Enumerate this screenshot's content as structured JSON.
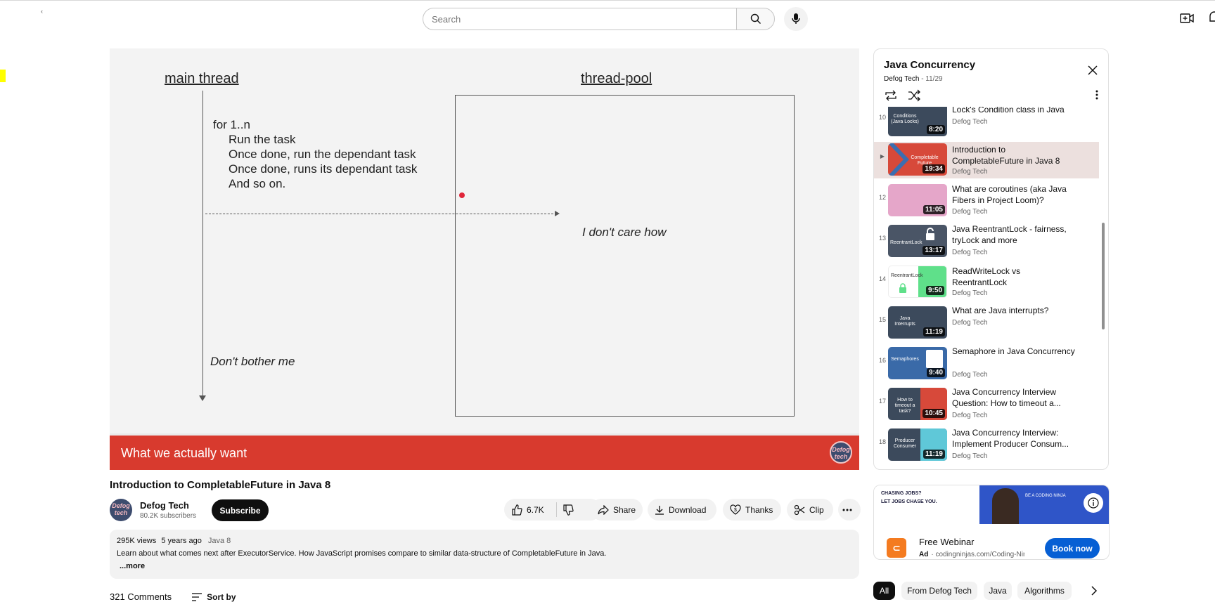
{
  "header": {
    "search_placeholder": "Search"
  },
  "video": {
    "slide": {
      "main_thread_title": "main thread",
      "pool_title": "thread-pool",
      "task_lines": [
        "for 1..n",
        "Run the task",
        "Once done, run the dependant task",
        "Once done, runs its dependant task",
        "And so on."
      ],
      "dont_care": "I don't care how",
      "dont_bother": "Don't bother me",
      "band_text": "What we actually want",
      "logo_text": "Defog tech"
    },
    "title": "Introduction to CompletableFuture in Java 8"
  },
  "channel": {
    "name": "Defog Tech",
    "subscribers": "80.2K subscribers",
    "avatar_text": "Defog tech",
    "subscribe_label": "Subscribe"
  },
  "actions": {
    "likes": "6.7K",
    "share": "Share",
    "download": "Download",
    "thanks": "Thanks",
    "clip": "Clip"
  },
  "description": {
    "views": "295K views",
    "age": "5 years ago",
    "tag": "Java 8",
    "text": "Learn about what comes next after ExecutorService. How JavaScript promises compare to similar data-structure of CompletableFuture in Java.",
    "more": "...more"
  },
  "comments": {
    "count": "321 Comments",
    "sort": "Sort by"
  },
  "playlist": {
    "title": "Java Concurrency",
    "owner": "Defog Tech",
    "position": "11/29",
    "items": [
      {
        "index": "10",
        "title": "Lock's Condition class in Java",
        "channel": "Defog Tech",
        "duration": "8:20",
        "thumb_label": "Conditions (Java Locks)",
        "thumb_color": "#3c4a5c"
      },
      {
        "index": "▶",
        "title": "Introduction to CompletableFuture in Java 8",
        "channel": "Defog Tech",
        "duration": "19:34",
        "thumb_label": "Completable Future",
        "thumb_color": "#d7493a"
      },
      {
        "index": "12",
        "title": "What are coroutines (aka Java Fibers in Project Loom)?",
        "channel": "Defog Tech",
        "duration": "11:05",
        "thumb_label": "",
        "thumb_color": "#e5a6c9"
      },
      {
        "index": "13",
        "title": "Java ReentrantLock - fairness, tryLock and more",
        "channel": "Defog Tech",
        "duration": "13:17",
        "thumb_label": "ReentrantLock",
        "thumb_color": "#4a5566"
      },
      {
        "index": "14",
        "title": "ReadWriteLock vs ReentrantLock",
        "channel": "Defog Tech",
        "duration": "9:50",
        "thumb_label": "ReentrantLock",
        "thumb_color": "#ffffff"
      },
      {
        "index": "15",
        "title": "What are Java interrupts?",
        "channel": "Defog Tech",
        "duration": "11:19",
        "thumb_label": "Java Interrupts",
        "thumb_color": "#3c4a5c"
      },
      {
        "index": "16",
        "title": "Semaphore in Java Concurrency",
        "channel": "Defog Tech",
        "duration": "9:40",
        "thumb_label": "Semaphores",
        "thumb_color": "#3a6aa8"
      },
      {
        "index": "17",
        "title": "Java Concurrency Interview Question: How to timeout a...",
        "channel": "Defog Tech",
        "duration": "10:45",
        "thumb_label": "How to timeout a task?",
        "thumb_color": "#3c4a5c"
      },
      {
        "index": "18",
        "title": "Java Concurrency Interview: Implement Producer Consum...",
        "channel": "Defog Tech",
        "duration": "11:19",
        "thumb_label": "Producer Consumer",
        "thumb_color": "#3c4a5c"
      }
    ]
  },
  "ad": {
    "banner_line1": "CHASING JOBS?",
    "banner_line2": "LET JOBS CHASE YOU.",
    "banner_cta": "BE A CODING NINJA",
    "title": "Free Webinar",
    "label": "Ad",
    "url": "codingninjas.com/Coding-Ninjas/",
    "button": "Book now"
  },
  "chips": [
    "All",
    "From Defog Tech",
    "Java",
    "Algorithms"
  ]
}
